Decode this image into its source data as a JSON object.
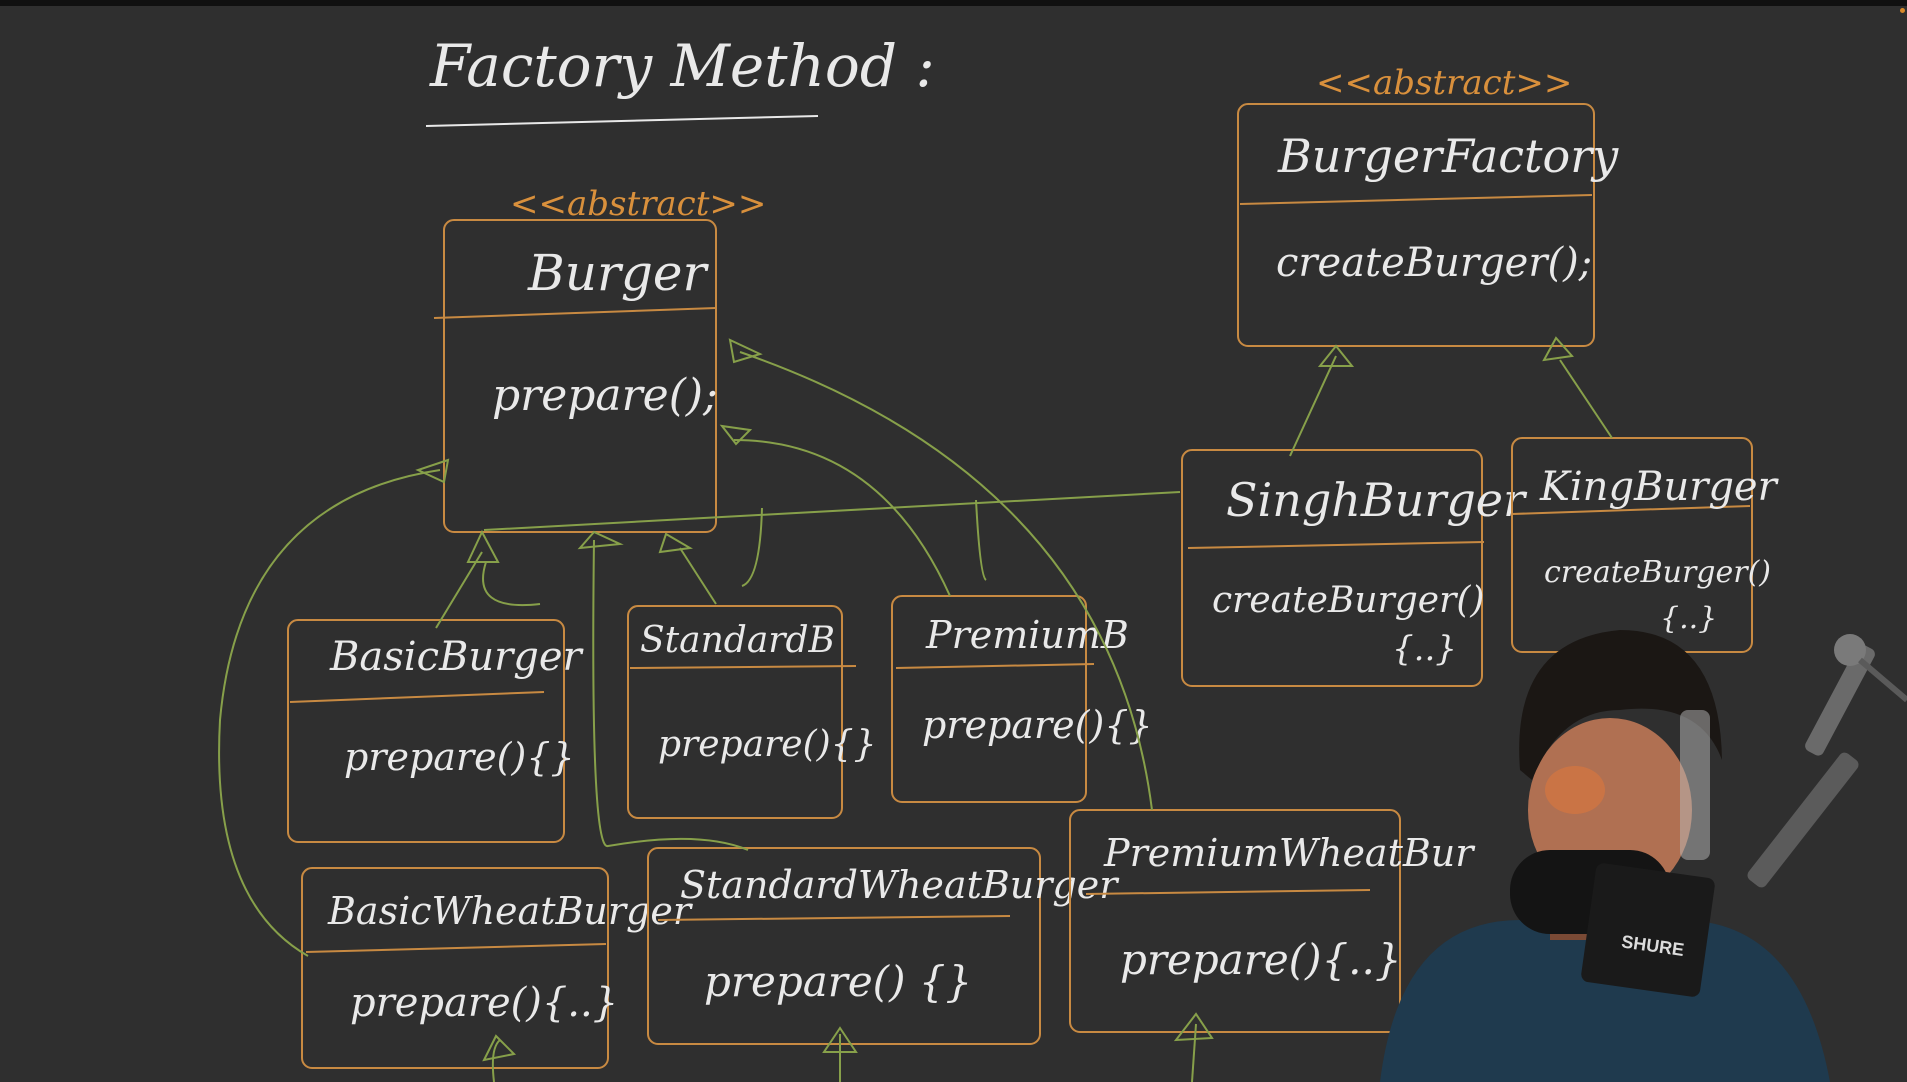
{
  "title": "Factory Method :",
  "stereotype": "<<abstract>>",
  "classes": {
    "burger": {
      "name": "Burger",
      "method": "prepare();"
    },
    "burger_factory": {
      "name": "BurgerFactory",
      "method": "createBurger();"
    },
    "singh_burger": {
      "name": "SinghBurger",
      "method": "createBurger()",
      "body": "{..}"
    },
    "king_burger": {
      "name": "KingBurger",
      "method": "createBurger()",
      "body": "{..}"
    },
    "basic_burger": {
      "name": "BasicBurger",
      "method": "prepare(){}"
    },
    "standard_burger": {
      "name": "StandardB",
      "method": "prepare(){}"
    },
    "premium_burger": {
      "name": "PremiumB",
      "method": "prepare(){}"
    },
    "basic_wheat_burger": {
      "name": "BasicWheatBurger",
      "method": "prepare(){..}"
    },
    "standard_wheat_burger": {
      "name": "StandardWheatBurger",
      "method": "prepare() {}"
    },
    "premium_wheat_burger": {
      "name": "PremiumWheatBur",
      "method": "prepare(){..}"
    }
  },
  "mic_brand": "SHURE",
  "colors": {
    "board": "#2f2f2f",
    "chalk": "#e9e9e9",
    "box_stroke": "#c88a42",
    "arrow": "#87a04a"
  }
}
